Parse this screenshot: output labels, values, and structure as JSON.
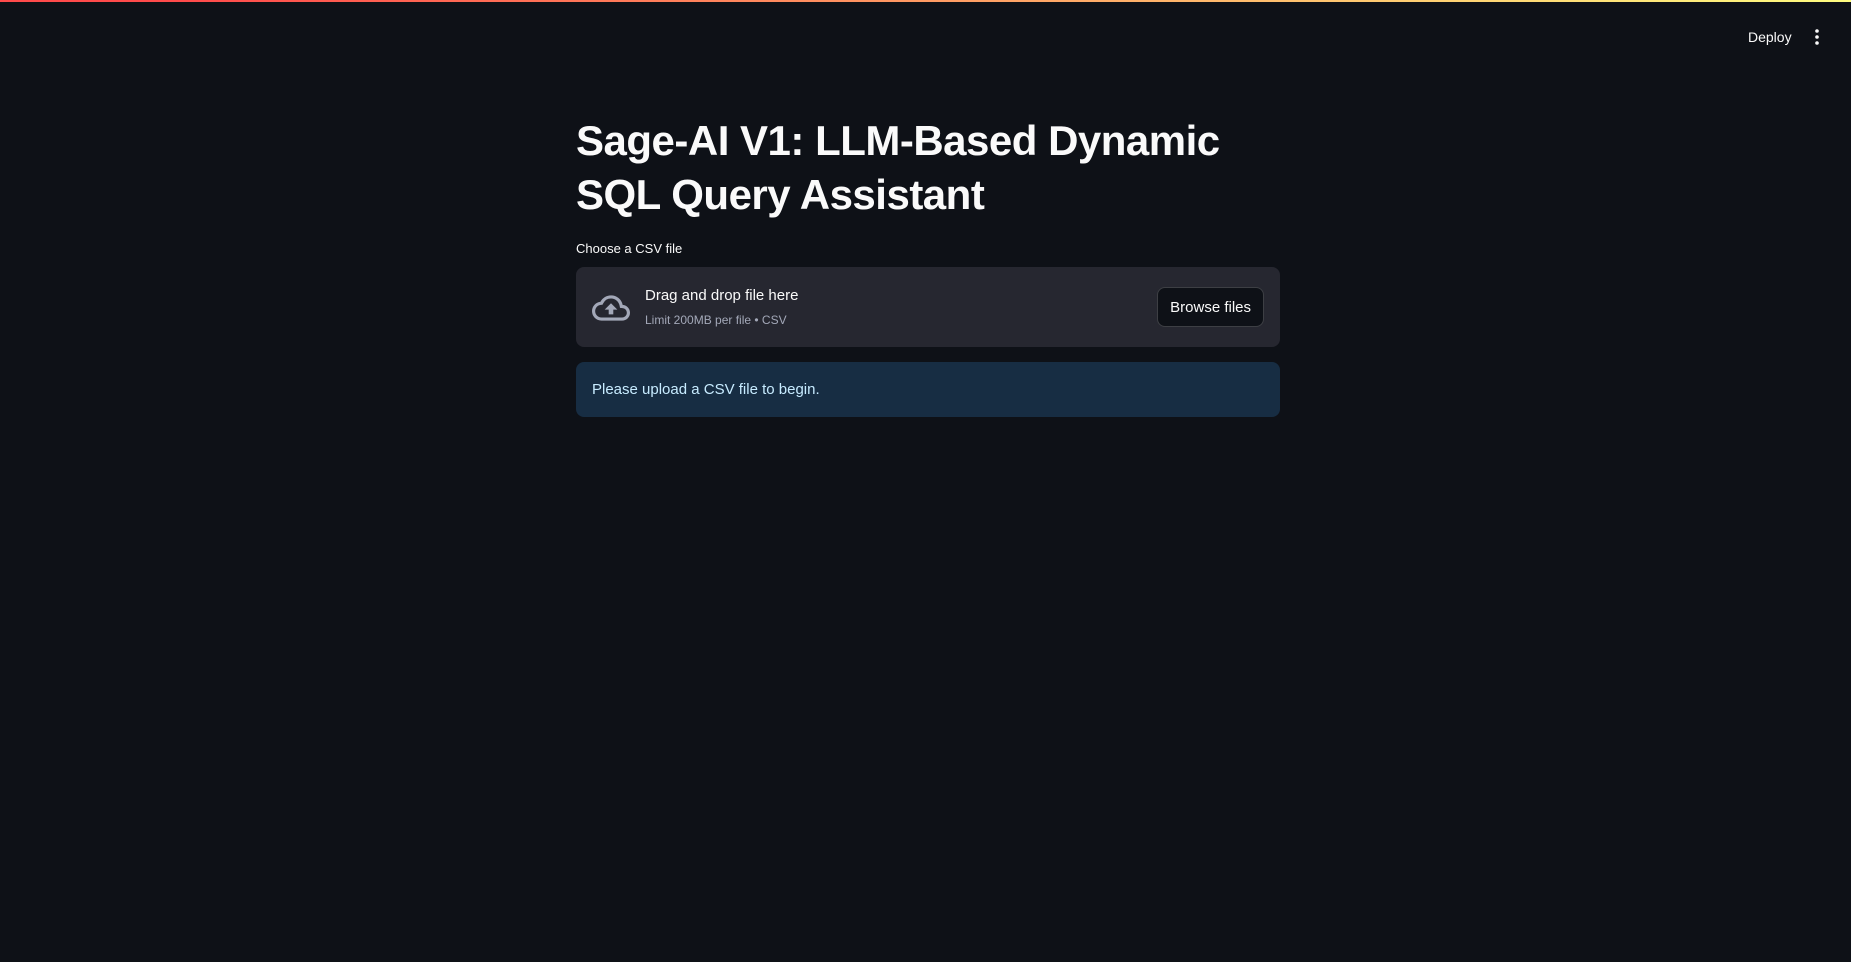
{
  "header": {
    "deploy_label": "Deploy",
    "menu_icon": "more-vertical-icon"
  },
  "main": {
    "title": "Sage-AI V1: LLM-Based Dynamic SQL Query Assistant",
    "uploader": {
      "label": "Choose a CSV file",
      "drop_title": "Drag and drop file here",
      "drop_hint": "Limit 200MB per file • CSV",
      "browse_label": "Browse files",
      "icon": "cloud-upload-icon"
    },
    "info_message": "Please upload a CSV file to begin."
  },
  "colors": {
    "background": "#0e1117",
    "dropzone": "#262730",
    "info_background": "#172d43",
    "info_text": "#c7ebff",
    "accent_start": "#ff4b4b",
    "accent_end": "#fffd80"
  }
}
